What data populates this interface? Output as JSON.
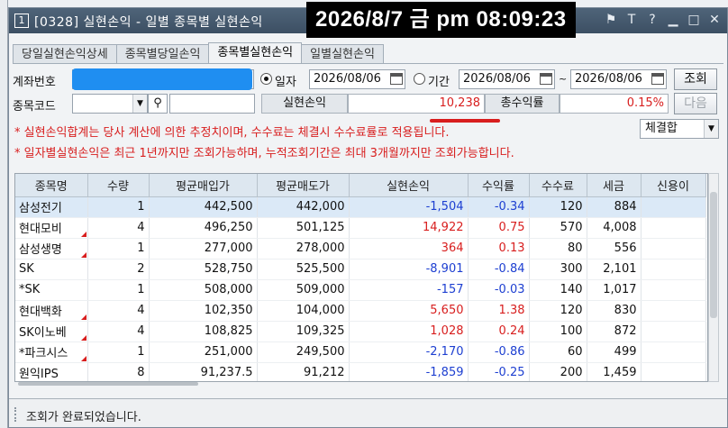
{
  "window": {
    "number": "1",
    "title": "[0328] 실현손익 - 일별 종목별 실현손익",
    "clock": "2026/8/7 금 pm 08:09:23",
    "icons": [
      "pin-icon",
      "font-size-icon",
      "help-icon",
      "minimize-icon",
      "maximize-icon",
      "close-icon"
    ]
  },
  "tabs": [
    {
      "label": "당일실현손익상세",
      "active": false
    },
    {
      "label": "종목별당일손익",
      "active": false
    },
    {
      "label": "종목별실현손익",
      "active": true
    },
    {
      "label": "일별실현손익",
      "active": false
    }
  ],
  "form": {
    "account_label": "계좌번호",
    "stock_code_label": "종목코드",
    "date_mode": {
      "single_label": "일자",
      "range_label": "기간",
      "selected": "single"
    },
    "single_date": "2026/08/06",
    "range_start": "2026/08/06",
    "range_sep": "~",
    "range_end": "2026/08/06",
    "search_button": "조회",
    "next_button": "다음",
    "realized_label": "실현손익",
    "realized_value": "10,238",
    "total_rate_label": "총수익률",
    "total_rate_value": "0.15%",
    "settle_select": "체결합",
    "notice1": "* 실현손익합계는 당사 계산에 의한 추정치이며, 수수료는 체결시 수수료률로 적용됩니다.",
    "notice2": "* 일자별실현손익은 최근 1년까지만 조회가능하며, 누적조회기간은 최대 3개월까지만 조회가능합니다."
  },
  "table": {
    "columns": [
      "종목명",
      "수량",
      "평균매입가",
      "평균매도가",
      "실현손익",
      "수익률",
      "수수료",
      "세금",
      "신용이"
    ],
    "rows": [
      {
        "name": "삼성전기",
        "qty": "1",
        "buy": "442,500",
        "sell": "442,000",
        "pnl": "-1,504",
        "rate": "-0.34",
        "fee": "120",
        "tax": "884",
        "credit": "",
        "flag": false,
        "selected": true
      },
      {
        "name": "현대모비",
        "qty": "4",
        "buy": "496,250",
        "sell": "501,125",
        "pnl": "14,922",
        "rate": "0.75",
        "fee": "570",
        "tax": "4,008",
        "credit": "",
        "flag": true,
        "selected": false
      },
      {
        "name": "삼성생명",
        "qty": "1",
        "buy": "277,000",
        "sell": "278,000",
        "pnl": "364",
        "rate": "0.13",
        "fee": "80",
        "tax": "556",
        "credit": "",
        "flag": true,
        "selected": false
      },
      {
        "name": "SK",
        "qty": "2",
        "buy": "528,750",
        "sell": "525,500",
        "pnl": "-8,901",
        "rate": "-0.84",
        "fee": "300",
        "tax": "2,101",
        "credit": "",
        "flag": false,
        "selected": false
      },
      {
        "name": "*SK",
        "qty": "1",
        "buy": "508,000",
        "sell": "509,000",
        "pnl": "-157",
        "rate": "-0.03",
        "fee": "140",
        "tax": "1,017",
        "credit": "",
        "flag": false,
        "selected": false
      },
      {
        "name": "현대백화",
        "qty": "4",
        "buy": "102,350",
        "sell": "104,000",
        "pnl": "5,650",
        "rate": "1.38",
        "fee": "120",
        "tax": "830",
        "credit": "",
        "flag": true,
        "selected": false
      },
      {
        "name": "SK이노베",
        "qty": "4",
        "buy": "108,825",
        "sell": "109,325",
        "pnl": "1,028",
        "rate": "0.24",
        "fee": "100",
        "tax": "872",
        "credit": "",
        "flag": true,
        "selected": false
      },
      {
        "name": "*파크시스",
        "qty": "1",
        "buy": "251,000",
        "sell": "249,500",
        "pnl": "-2,170",
        "rate": "-0.86",
        "fee": "60",
        "tax": "499",
        "credit": "",
        "flag": true,
        "selected": false
      },
      {
        "name": "원익IPS",
        "qty": "8",
        "buy": "91,237.5",
        "sell": "91,212",
        "pnl": "-1,859",
        "rate": "-0.25",
        "fee": "200",
        "tax": "1,459",
        "credit": "",
        "flag": false,
        "selected": false
      }
    ]
  },
  "status": {
    "text": "조회가 완료되었습니다."
  },
  "colors": {
    "profit": "#d81e1e",
    "loss": "#1d3fd1",
    "titlebar": "#3c4f63",
    "header": "#dde7f0",
    "masked": "#1f8ef1"
  }
}
